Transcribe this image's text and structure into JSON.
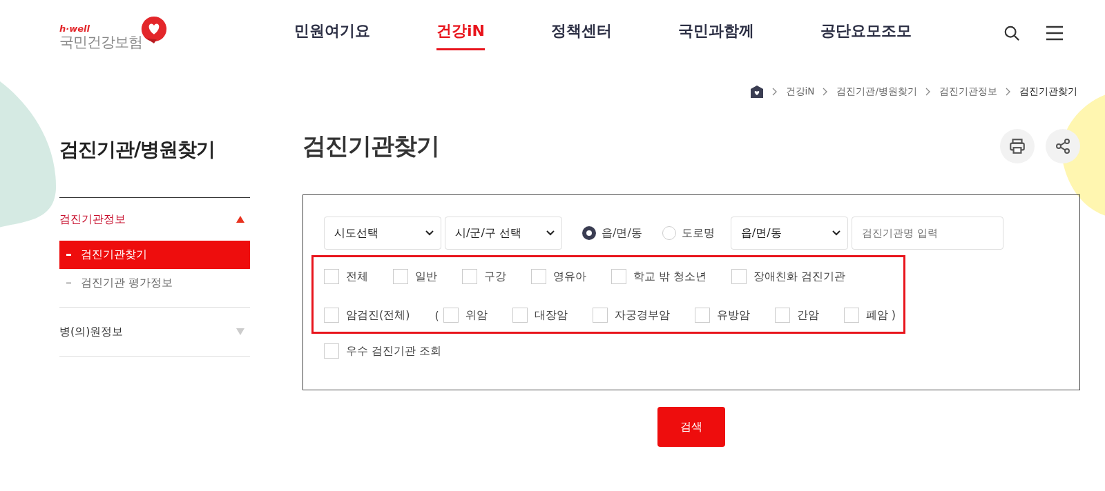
{
  "header": {
    "logo": {
      "tagline": "h·well",
      "name": "국민건강보험"
    },
    "nav": [
      {
        "label": "민원여기요",
        "selected": false
      },
      {
        "label": "건강iN",
        "selected": true
      },
      {
        "label": "정책센터",
        "selected": false
      },
      {
        "label": "국민과함께",
        "selected": false
      },
      {
        "label": "공단요모조모",
        "selected": false
      }
    ]
  },
  "breadcrumb": [
    "건강iN",
    "검진기관/병원찾기",
    "검진기관정보",
    "검진기관찾기"
  ],
  "sidebar": {
    "title": "검진기관/병원찾기",
    "groups": [
      {
        "label": "검진기관정보",
        "expanded": true,
        "children": [
          {
            "label": "검진기관찾기",
            "selected": true
          },
          {
            "label": "검진기관 평가정보",
            "selected": false
          }
        ]
      },
      {
        "label": "병(의)원정보",
        "expanded": false
      }
    ]
  },
  "page_title": "검진기관찾기",
  "search_form": {
    "selects": [
      "시도선택",
      "시/군/구 선택"
    ],
    "radios": [
      {
        "label": "읍/면/동",
        "selected": true
      },
      {
        "label": "도로명",
        "selected": false
      }
    ],
    "select_3": "읍/면/동",
    "name_input": {
      "placeholder": "검진기관명 입력"
    },
    "checkbox_rows": [
      [
        {
          "kind": "checkbox",
          "label": "전체",
          "checked": false
        },
        {
          "kind": "checkbox",
          "label": "일반",
          "checked": false
        },
        {
          "kind": "checkbox",
          "label": "구강",
          "checked": false
        },
        {
          "kind": "checkbox",
          "label": "영유아",
          "checked": false
        },
        {
          "kind": "checkbox",
          "label": "학교 밖 청소년",
          "checked": false
        },
        {
          "kind": "checkbox",
          "label": "장애친화 검진기관",
          "checked": false
        }
      ],
      [
        {
          "kind": "checkbox",
          "label": "암검진(전체)",
          "checked": false
        },
        {
          "kind": "text",
          "label": "("
        },
        {
          "kind": "checkbox",
          "label": "위암",
          "checked": false
        },
        {
          "kind": "checkbox",
          "label": "대장암",
          "checked": false
        },
        {
          "kind": "checkbox",
          "label": "자궁경부암",
          "checked": false
        },
        {
          "kind": "checkbox",
          "label": "유방암",
          "checked": false
        },
        {
          "kind": "checkbox",
          "label": "간암",
          "checked": false
        },
        {
          "kind": "checkbox",
          "label": "폐암 )",
          "checked": false
        }
      ]
    ],
    "excellent": {
      "label": "우수 검진기관 조회",
      "checked": false
    }
  },
  "search_button": "검색"
}
